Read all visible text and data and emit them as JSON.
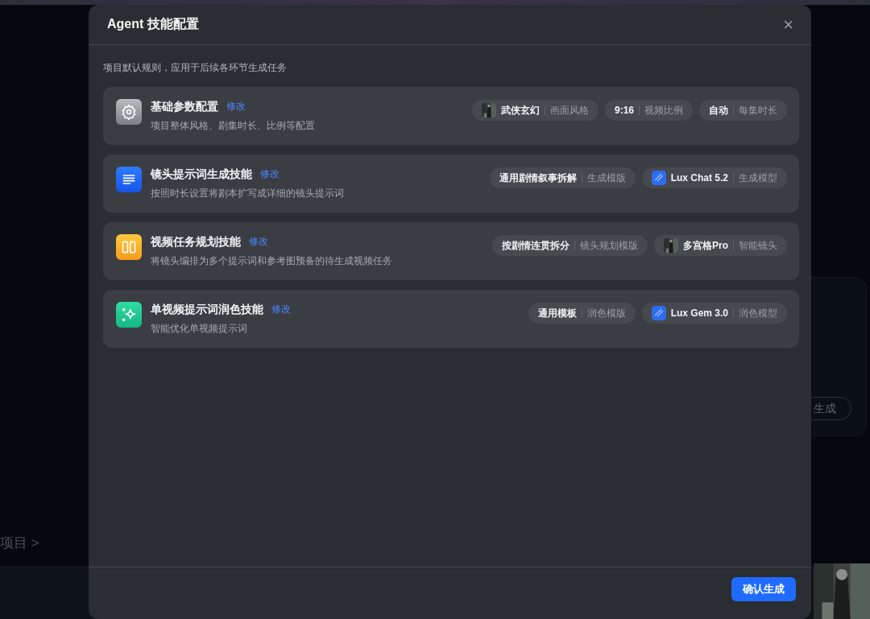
{
  "background": {
    "breadcrumb": "项目 >",
    "button": "生成"
  },
  "dialog": {
    "title": "Agent 技能配置",
    "close": "×",
    "subtitle": "项目默认规则，应用于后续各环节生成任务",
    "skills": [
      {
        "kind": "gear",
        "title": "基础参数配置",
        "edit": "修改",
        "description": "项目整体风格、剧集时长、比例等配置",
        "chips": [
          {
            "kind": "picture",
            "value": "武侠玄幻",
            "label": "画面风格"
          },
          {
            "kind": "plain",
            "value": "9:16",
            "label": "视频比例"
          },
          {
            "kind": "plain",
            "value": "自动",
            "label": "每集时长"
          }
        ]
      },
      {
        "kind": "document",
        "title": "镜头提示词生成技能",
        "edit": "修改",
        "description": "按照时长设置将剧本扩写成详细的镜头提示词",
        "chips": [
          {
            "kind": "plain",
            "value": "通用剧情叙事拆解",
            "label": "生成模版"
          },
          {
            "kind": "model",
            "value": "Lux Chat 5.2",
            "label": "生成模型"
          }
        ]
      },
      {
        "kind": "columns",
        "title": "视频任务规划技能",
        "edit": "修改",
        "description": "将镜头编排为多个提示词和参考图预备的待生成视频任务",
        "chips": [
          {
            "kind": "plain",
            "value": "按剧情连贯拆分",
            "label": "镜头规划模版"
          },
          {
            "kind": "picture",
            "value": "多宫格Pro",
            "label": "智能镜头"
          }
        ]
      },
      {
        "kind": "sparkle",
        "title": "单视频提示词润色技能",
        "edit": "修改",
        "description": "智能优化单视频提示词",
        "chips": [
          {
            "kind": "plain",
            "value": "通用模板",
            "label": "润色模版"
          },
          {
            "kind": "model",
            "value": "Lux Gem 3.0",
            "label": "润色模型"
          }
        ]
      }
    ],
    "confirm": "确认生成"
  }
}
